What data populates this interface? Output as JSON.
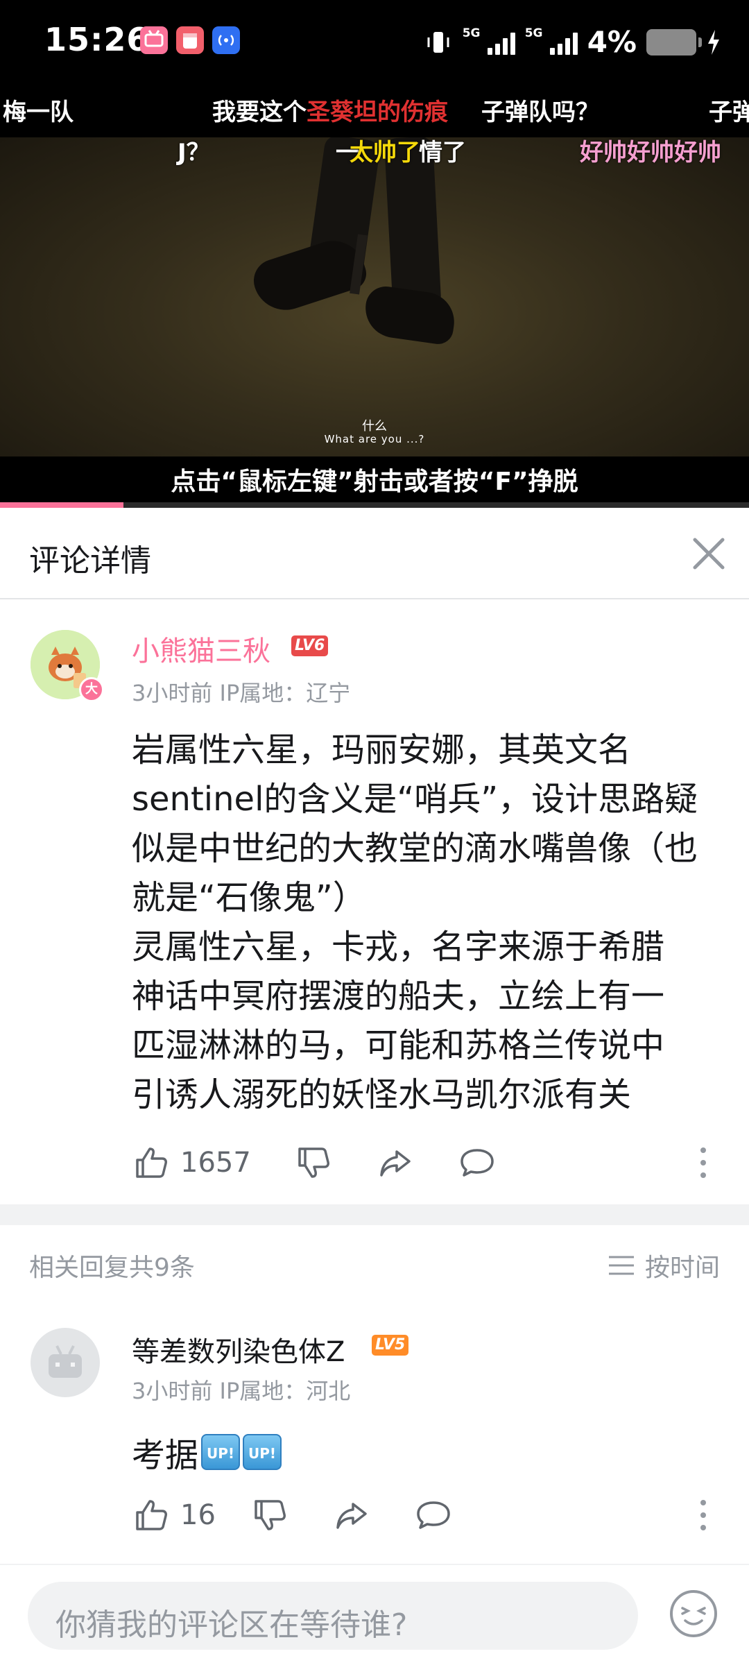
{
  "status_bar": {
    "time": "15:26",
    "network1": "5G",
    "network2": "5G",
    "battery": "4%",
    "icons": [
      "bilibili-app-icon",
      "notes-app-icon",
      "hotspot-icon",
      "vibrate-icon",
      "battery-icon",
      "charging-icon"
    ]
  },
  "video": {
    "danmaku": [
      {
        "text": "梅一队",
        "color": "#ffffff"
      },
      {
        "text": "我要这个",
        "color": "#ffffff"
      },
      {
        "text": "圣葵坦的伤痕",
        "color": "#e03131"
      },
      {
        "text": "子弹队吗？",
        "color": "#ffffff"
      },
      {
        "text": "子弹",
        "color": "#ffffff"
      },
      {
        "text": "J？",
        "color": "#ffffff"
      },
      {
        "text": "太帅了",
        "color": "#f5d90a"
      },
      {
        "text": "一",
        "color": "#ffffff"
      },
      {
        "text": "情了",
        "color": "#ffffff"
      },
      {
        "text": "好帅好帅好帅",
        "color": "#f59fcf"
      }
    ],
    "subtitle_cn": "什么",
    "subtitle_en": "What are you ...?",
    "hint": "点击“鼠标左键”射击或者按“F”挣脱",
    "progress_fraction": 0.165
  },
  "detail": {
    "title": "评论详情"
  },
  "main_comment": {
    "username": "小熊猫三秋",
    "level": "LV6",
    "avatar_badge": "大",
    "meta": "3小时前 IP属地：辽宁",
    "content": "岩属性六星，玛丽安娜，其英文名\nsentinel的含义是“哨兵”，设计思路疑\n似是中世纪的大教堂的滴水嘴兽像（也\n就是“石像鬼”）\n灵属性六星，卡戎，名字来源于希腊\n神话中冥府摆渡的船夫，立绘上有一\n匹湿淋淋的马，可能和苏格兰传说中\n引诱人溺死的妖怪水马凯尔派有关",
    "likes": "1657"
  },
  "replies_header": {
    "count_label": "相关回复共9条",
    "sort_label": "按时间"
  },
  "reply": {
    "username": "等差数列染色体Z",
    "level": "LV5",
    "meta": "3小时前 IP属地：河北",
    "text": "考据",
    "badge_text": "UP!",
    "likes": "16"
  },
  "input": {
    "placeholder": "你猜我的评论区在等待谁?"
  },
  "colors": {
    "accent_pink": "#fb7299",
    "username_pink": "#fb7299",
    "lv6_red": "#e84a4a",
    "lv5_orange": "#ff8c28",
    "meta_gray": "#9499a0"
  }
}
